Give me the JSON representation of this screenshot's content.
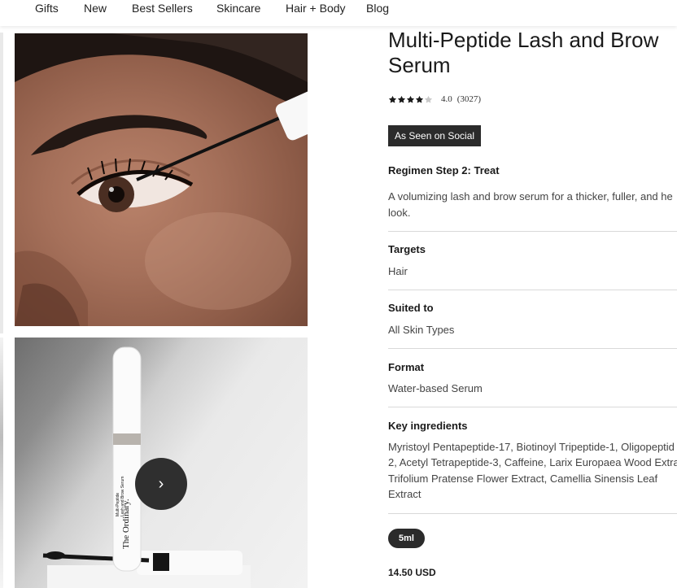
{
  "nav": {
    "items": [
      {
        "label": "Gifts"
      },
      {
        "label": "New"
      },
      {
        "label": "Best Sellers"
      },
      {
        "label": "Skincare"
      },
      {
        "label": "Hair + Body"
      },
      {
        "label": "Blog"
      }
    ]
  },
  "gallery": {
    "next_icon": "›",
    "product_label_lines": [
      "Multi-Peptide",
      "Lash and Brow Serum"
    ],
    "product_brand": "The Ordinary."
  },
  "product": {
    "title_line1": "Multi-Peptide Lash and Brow",
    "title_line2": "Serum",
    "rating": {
      "value": "4.0",
      "count": "(3027)",
      "stars_filled": 4,
      "stars_total": 5
    },
    "badge": "As Seen on Social",
    "regimen": "Regimen Step 2: Treat",
    "description_line1": "A volumizing lash and brow serum for a thicker, fuller, and he",
    "description_line2": "look.",
    "targets_label": "Targets",
    "targets_value": "Hair",
    "suited_label": "Suited to",
    "suited_value": "All Skin Types",
    "format_label": "Format",
    "format_value": "Water-based Serum",
    "ingredients_label": "Key ingredients",
    "ingredients_line1": "Myristoyl Pentapeptide-17, Biotinoyl Tripeptide-1, Oligopeptid",
    "ingredients_line2": "2, Acetyl Tetrapeptide-3, Caffeine, Larix Europaea Wood Extra",
    "ingredients_line3": "Trifolium Pratense Flower Extract, Camellia Sinensis Leaf",
    "ingredients_line4": "Extract",
    "size": "5ml",
    "price": "14.50 USD"
  },
  "colors": {
    "accent_dark": "#2b2b2b",
    "star_fill": "#1a1a1a",
    "star_empty": "#c8c8c8"
  }
}
